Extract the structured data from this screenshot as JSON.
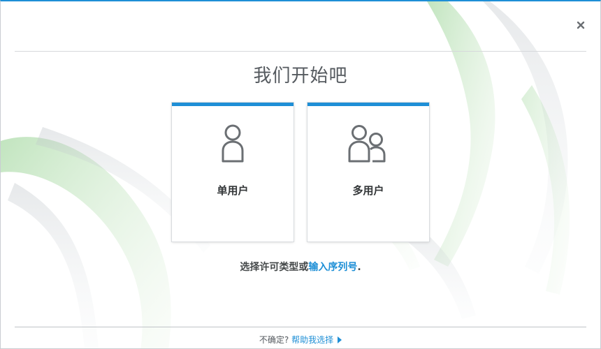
{
  "title": "我们开始吧",
  "cards": [
    {
      "label": "单用户",
      "icon": "single-user-icon"
    },
    {
      "label": "多用户",
      "icon": "multi-user-icon"
    }
  ],
  "hint": {
    "prefix": "选择许可类型或",
    "link": "输入序列号",
    "suffix": "."
  },
  "footer": {
    "prefix": "不确定?",
    "link": "帮助我选择"
  },
  "colors": {
    "accent": "#1e8fd6",
    "text": "#555a5f",
    "icon": "#6b6f73"
  }
}
